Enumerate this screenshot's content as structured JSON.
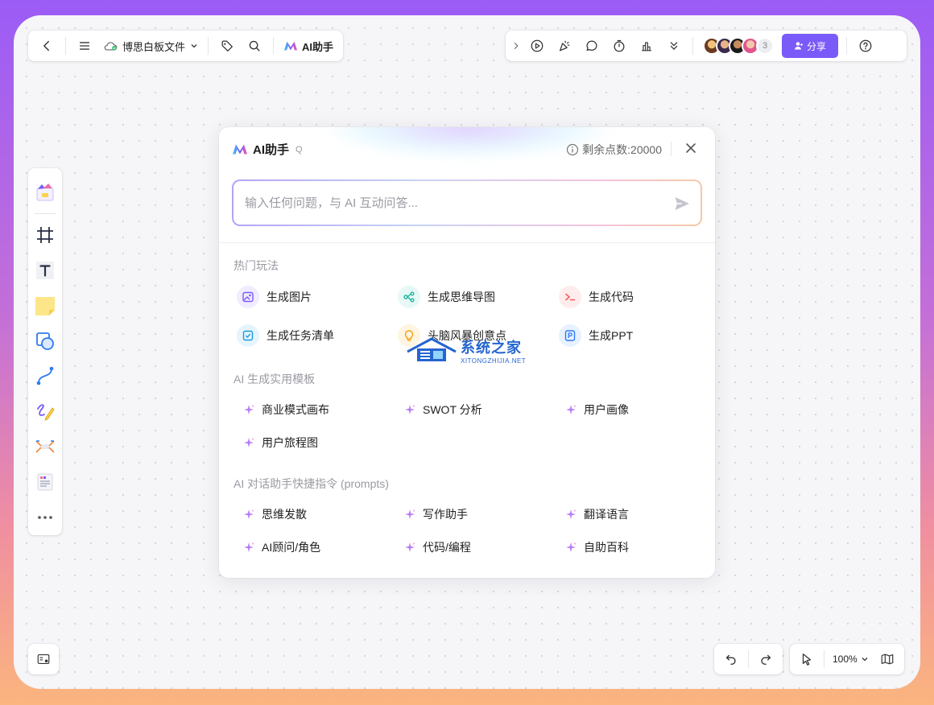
{
  "top_left": {
    "file_name": "博思白板文件",
    "ai_label": "AI助手"
  },
  "top_right": {
    "avatar_count": "3",
    "share_label": "分享"
  },
  "colors": {
    "accent": "#7a5af8"
  },
  "zoom": {
    "level": "100%"
  },
  "panel": {
    "title": "AI助手",
    "shortcut": "Q",
    "credits": "剩余点数:20000",
    "input_placeholder": "输入任何问题，与 AI 互动问答...",
    "sections": {
      "hot": {
        "title": "热门玩法",
        "items": [
          "生成图片",
          "生成思维导图",
          "生成代码",
          "生成任务清单",
          "头脑风暴创意点",
          "生成PPT"
        ]
      },
      "templates": {
        "title": "AI 生成实用模板",
        "items": [
          "商业模式画布",
          "SWOT 分析",
          "用户画像",
          "用户旅程图"
        ]
      },
      "prompts": {
        "title": "AI 对话助手快捷指令 (prompts)",
        "items": [
          "思维发散",
          "写作助手",
          "翻译语言",
          "AI顾问/角色",
          "代码/编程",
          "自助百科"
        ]
      }
    }
  },
  "watermark": {
    "title": "系统之家",
    "subtitle": "XITONGZHIJIA.NET"
  }
}
